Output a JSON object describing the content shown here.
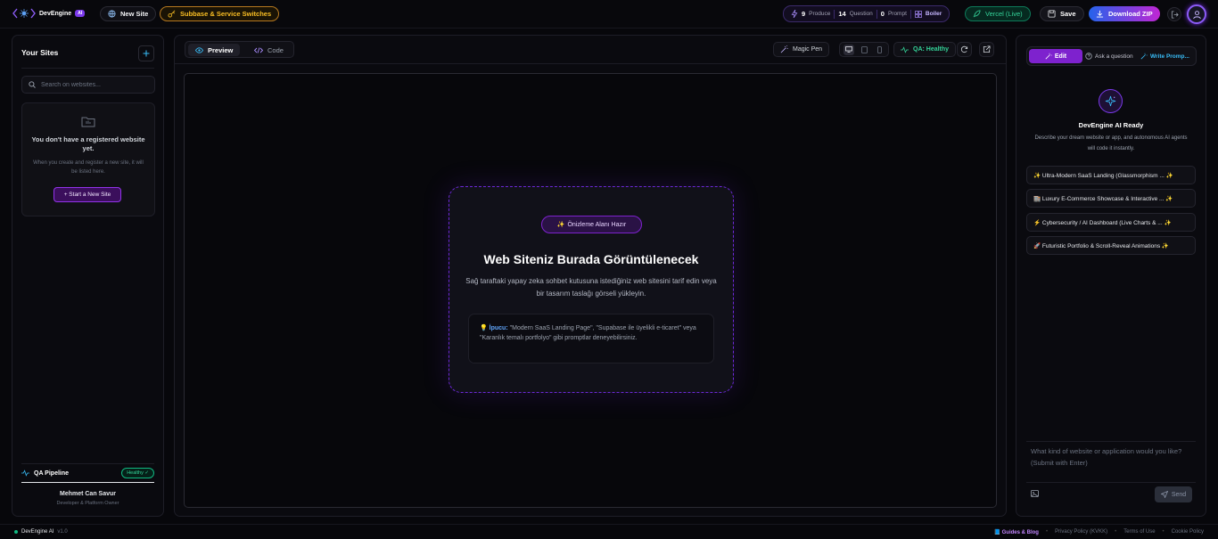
{
  "header": {
    "brand": "DevEngine",
    "brand_badge": "AI",
    "new_site": "New Site",
    "supabase": "Subbase & Service Switches",
    "stats": {
      "produce_count": "9",
      "produce_label": "Produce",
      "question_count": "14",
      "question_label": "Question",
      "prompt_count": "0",
      "prompt_label": "Prompt",
      "boiler_label": "Boiler"
    },
    "vercel": "Vercel (Live)",
    "save": "Save",
    "download": "Download ZIP"
  },
  "sidebar": {
    "title": "Your Sites",
    "search_placeholder": "Search on websites...",
    "empty_title": "You don't have a registered website yet.",
    "empty_desc": "When you create and register a new site, it will be listed here.",
    "start_button": "+ Start a New Site",
    "qa_label": "QA Pipeline",
    "qa_status": "Healthy ✓",
    "owner_name": "Mehmet Can Savur",
    "owner_role": "Developer & Platform Owner"
  },
  "center": {
    "tab_preview": "Preview",
    "tab_code": "Code",
    "magic_pen": "Magic Pen",
    "qa_health": "QA: Healthy",
    "placeholder": {
      "tag": "Önizleme Alanı Hazır",
      "title": "Web Siteniz Burada Görüntülenecek",
      "desc": "Sağ taraftaki yapay zeka sohbet kutusuna istediğiniz web sitesini tarif edin veya bir tasarım taslağı görseli yükleyin.",
      "tip_label": "İpucu:",
      "tip_text": "\"Modern SaaS Landing Page\", \"Supabase ile üyelikli e-ticaret\" veya \"Karanlık temalı portfolyo\" gibi promptlar deneyebilirsiniz."
    }
  },
  "assistant": {
    "tab_edit": "Edit",
    "tab_ask": "Ask a question",
    "tab_write": "Write Promp...",
    "ready_title": "DevEngine AI Ready",
    "ready_desc": "Describe your dream website or app, and autonomous AI agents will code it instantly.",
    "suggestions": [
      "✨ Ultra-Modern SaaS Landing (Glassmorphism ... ✨",
      "🏬 Luxury E-Commerce Showcase & Interactive ... ✨",
      "⚡ Cybersecurity / AI Dashboard (Live Charts & ... ✨",
      "🚀 Futuristic Portfolio & Scroll-Reveal Animations ✨"
    ],
    "input_placeholder": "What kind of website or application would you like? (Submit with Enter)",
    "send": "Send"
  },
  "footer": {
    "brand": "DevEngine AI",
    "version": "v1.0",
    "links": [
      "📘 Guides & Blog",
      "Privacy Policy (KVKK)",
      "Terms of Use",
      "Cookie Policy"
    ]
  },
  "colors": {
    "accent": "#7e22ce",
    "success": "#34d399",
    "warning": "#fbbf24",
    "link": "#38bdf8"
  },
  "icons": [
    "logo-icon",
    "globe-icon",
    "key-icon",
    "bolt-icon",
    "grid-icon",
    "rocket-icon",
    "save-icon",
    "download-icon",
    "logout-icon",
    "user-icon",
    "plus-icon",
    "search-icon",
    "folder-icon",
    "activity-icon",
    "eye-icon",
    "code-icon",
    "wand-icon",
    "desktop-icon",
    "tablet-icon",
    "mobile-icon",
    "refresh-icon",
    "external-link-icon",
    "sparkle-icon",
    "help-icon",
    "image-icon",
    "send-icon"
  ]
}
